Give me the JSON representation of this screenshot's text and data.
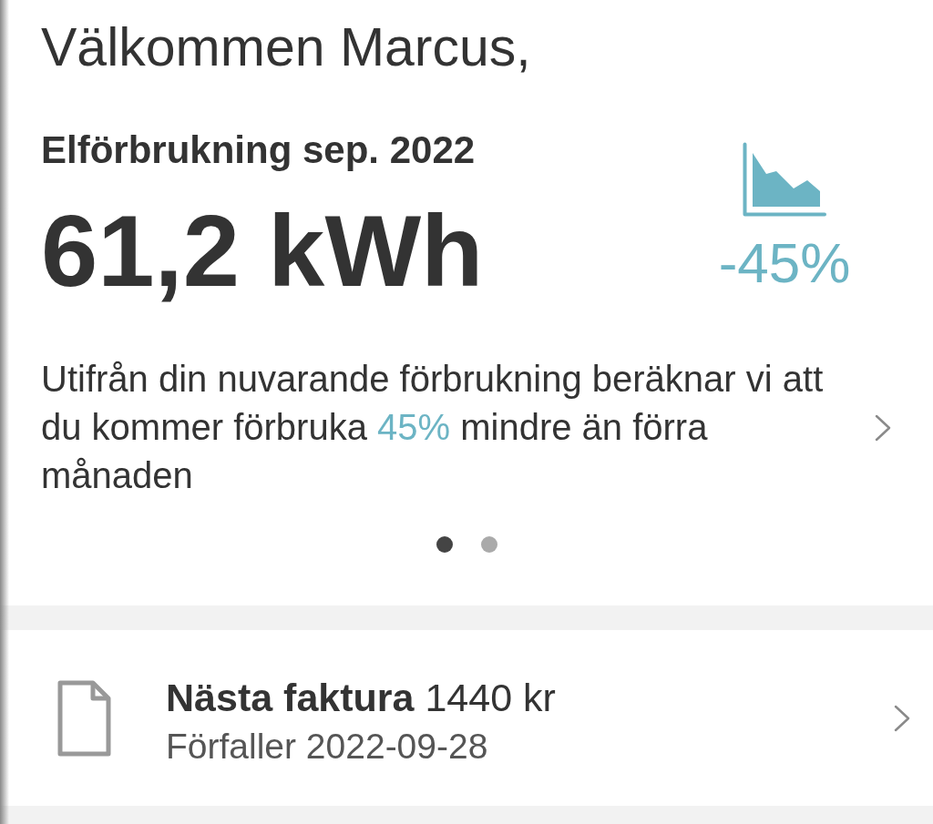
{
  "greeting": "Välkommen Marcus,",
  "usage": {
    "title": "Elförbrukning sep. 2022",
    "amount": "61,2 kWh",
    "change": "-45%",
    "forecast": {
      "before": "Utifrån din nuvarande förbrukning beräknar vi att du kommer förbruka ",
      "highlight": "45%",
      "after": " mindre än förra månaden"
    }
  },
  "carousel": [
    {
      "selected": true
    },
    {
      "selected": false
    }
  ],
  "invoice": {
    "title": "**Nästa faktura** 1440 kr",
    "due": "Förfaller 2022-09-28"
  }
}
